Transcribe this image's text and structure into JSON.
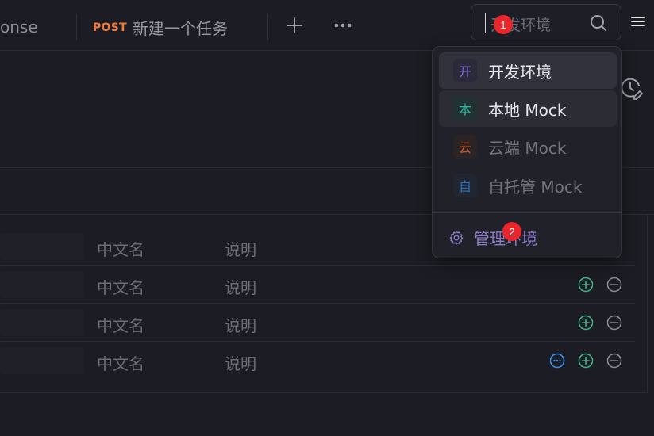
{
  "tabs": {
    "prev_label": "onse",
    "active": {
      "method": "POST",
      "title": "新建一个任务"
    }
  },
  "env_selector": {
    "current_value": "开发环境",
    "search_icon": "search-icon"
  },
  "dropdown": {
    "items": [
      {
        "badge": "开",
        "label": "开发环境",
        "badge_color": "#7b68c6",
        "badge_bg": "#2c2a3a"
      },
      {
        "badge": "本",
        "label": "本地 Mock",
        "badge_color": "#2bb3a1",
        "badge_bg": "#223233"
      },
      {
        "badge": "云",
        "label": "云端 Mock",
        "badge_color": "#c8572e",
        "badge_bg": "#2b2424"
      },
      {
        "badge": "自",
        "label": "自托管 Mock",
        "badge_color": "#2f6fb8",
        "badge_bg": "#212633"
      }
    ],
    "manage_label": "管理环境"
  },
  "table": {
    "rows": [
      {
        "cn": "中文名",
        "desc": "说明"
      },
      {
        "cn": "中文名",
        "desc": "说明"
      },
      {
        "cn": "中文名",
        "desc": "说明"
      },
      {
        "cn": "中文名",
        "desc": "说明"
      }
    ]
  },
  "markers": [
    "1",
    "2"
  ],
  "colors": {
    "accent_green": "#3fb27f",
    "accent_blue": "#3a8ee6",
    "method_post": "#f07a38"
  }
}
